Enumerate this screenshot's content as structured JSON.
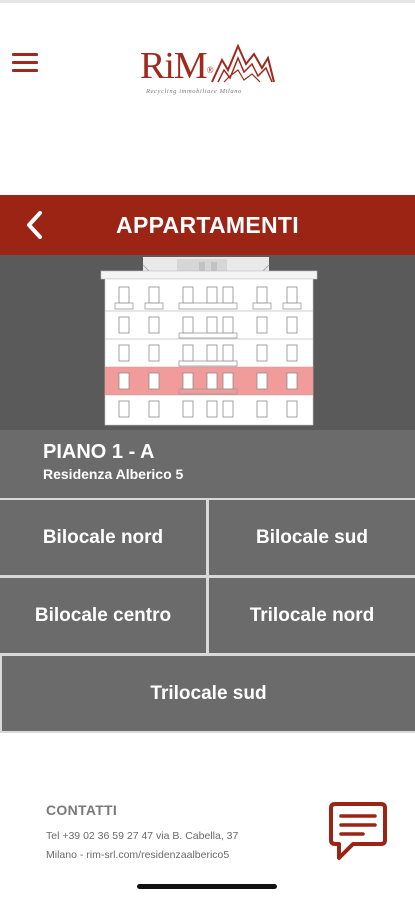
{
  "header": {
    "menu_icon": "hamburger-menu-icon",
    "logo": {
      "word": "RiM",
      "registered": "®",
      "tagline": "Recycling immobiliare Milano"
    }
  },
  "titlebar": {
    "back_icon": "chevron-left-icon",
    "title": "APPARTAMENTI"
  },
  "building": {
    "highlighted_floor": "1",
    "highlight_color": "#f08a8a"
  },
  "floor_info": {
    "title": "PIANO 1 - A",
    "subtitle": "Residenza Alberico 5"
  },
  "apartments": [
    {
      "label": "Bilocale nord"
    },
    {
      "label": "Bilocale sud"
    },
    {
      "label": "Bilocale centro"
    },
    {
      "label": "Trilocale nord"
    },
    {
      "label": "Trilocale sud"
    }
  ],
  "contacts": {
    "title": "CONTATTI",
    "line1": "Tel +39 02 36 59 27 47 via B. Cabella, 37",
    "line2": "Milano - rim-srl.com/residenzaalberico5",
    "chat_icon": "chat-bubble-icon"
  },
  "colors": {
    "brand": "#9b2415",
    "panel": "#6b6b6b",
    "building_bg": "#5a5a5a"
  }
}
